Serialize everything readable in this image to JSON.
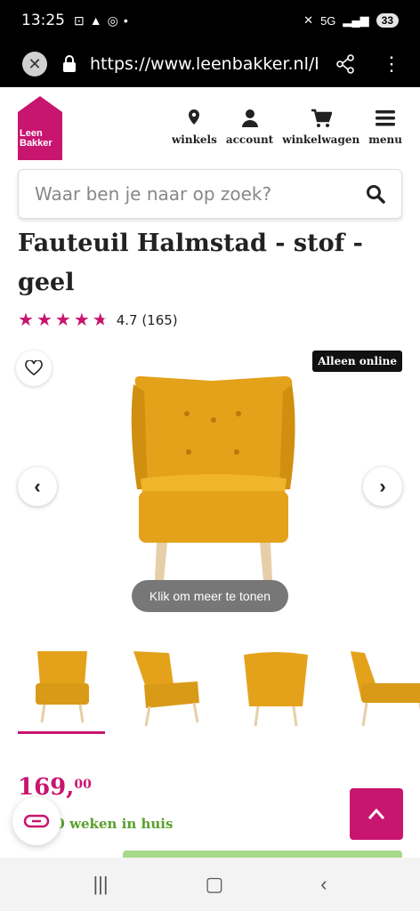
{
  "status": {
    "time": "13:25",
    "battery": "33",
    "network": "5G"
  },
  "browser": {
    "url": "https://www.leenbakker.nl/ba"
  },
  "header": {
    "logo_line1": "Leen",
    "logo_line2": "Bakker",
    "nav": [
      {
        "label": "winkels",
        "icon": "location-pin-icon"
      },
      {
        "label": "account",
        "icon": "user-icon"
      },
      {
        "label": "winkelwagen",
        "icon": "cart-icon"
      },
      {
        "label": "menu",
        "icon": "hamburger-icon"
      }
    ]
  },
  "search": {
    "placeholder": "Waar ben je naar op zoek?"
  },
  "product": {
    "title": "Fauteuil Halmstad - stof - geel",
    "rating_value": "4.7",
    "rating_count": "(165)",
    "rating_stars": 4.7,
    "badge": "Alleen online",
    "show_more": "Klik om meer te tonen",
    "price_main": "169,",
    "price_cents": "00",
    "delivery": "20 weken in huis"
  },
  "colors": {
    "brand": "#c8156f",
    "delivery_green": "#5aa02c",
    "chair": "#e3a21a"
  }
}
